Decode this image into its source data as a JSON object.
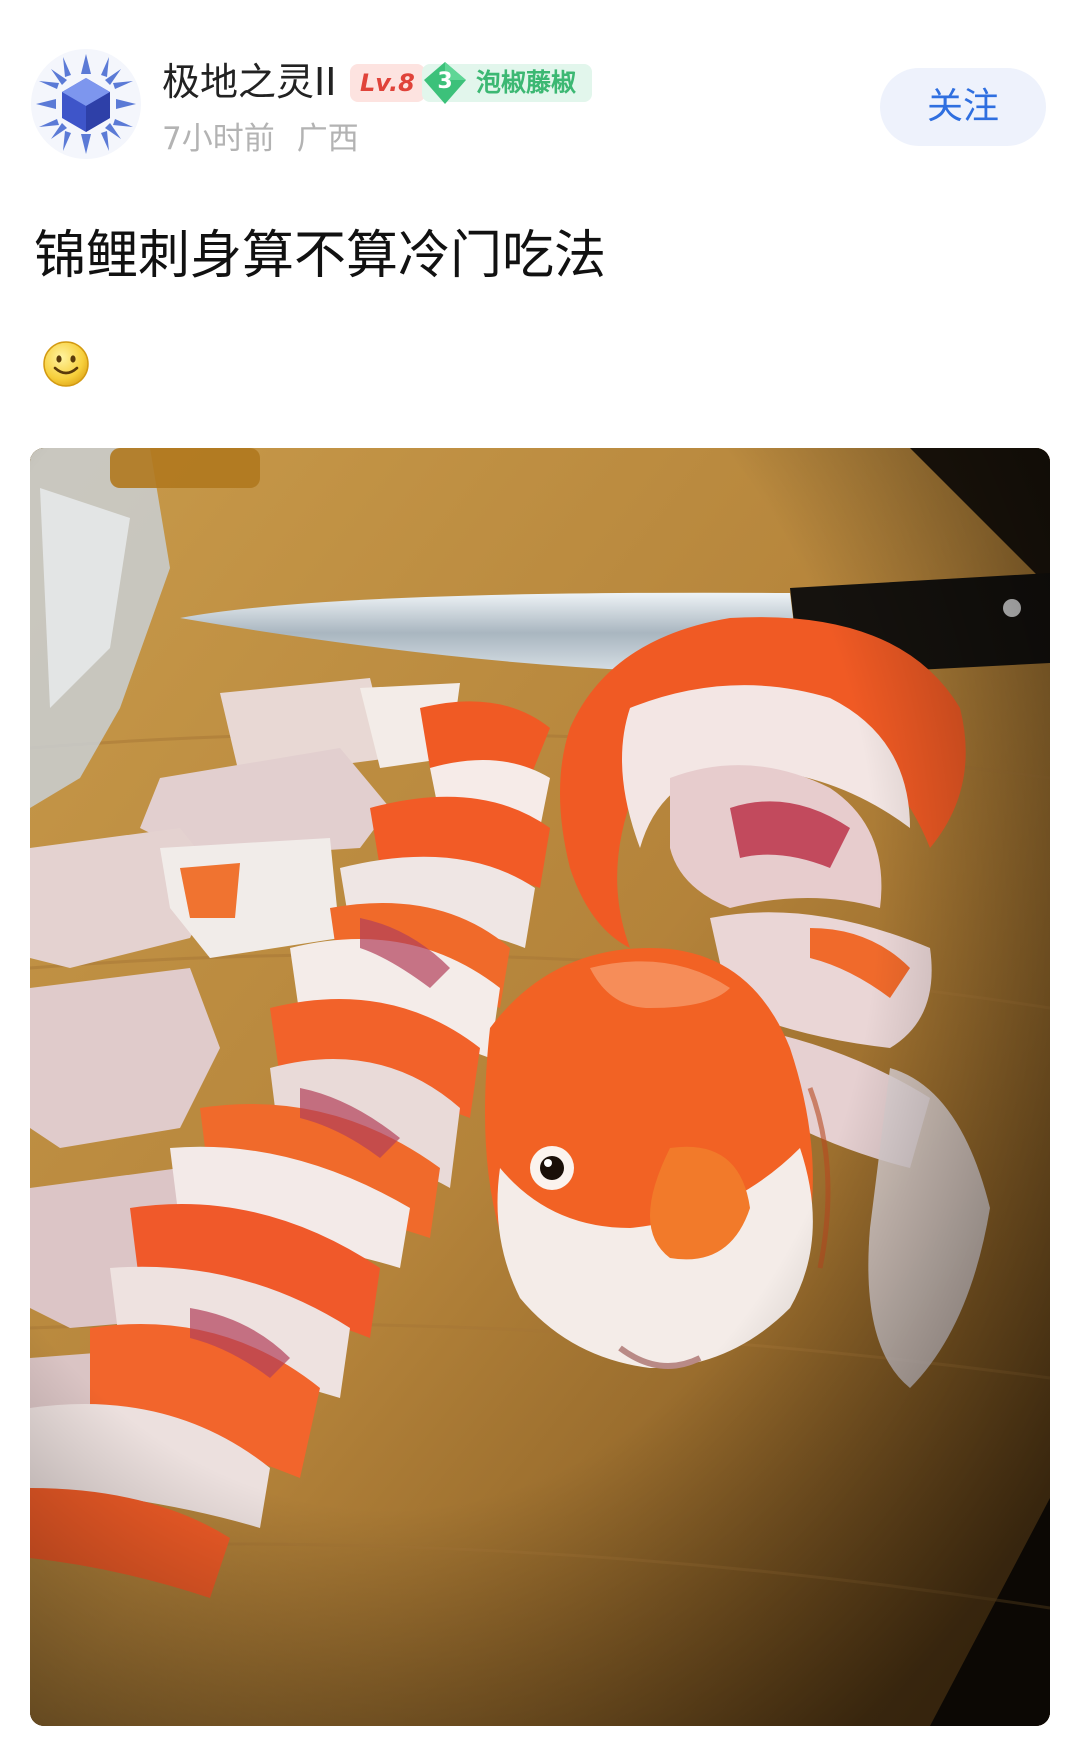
{
  "post": {
    "author": {
      "name": "极地之灵II",
      "level": "Lv.8",
      "circle_level": "3",
      "circle_name": "泡椒藤椒",
      "time": "7小时前",
      "location": "广西"
    },
    "follow_label": "关注",
    "title": "锦鲤刺身算不算冷门吃法",
    "emoji": "smiling-face",
    "image": "koi-sashimi-photo"
  },
  "colors": {
    "follow_text": "#2f6fe0",
    "follow_bg": "#eef2fc",
    "level_text": "#e0433a",
    "level_bg": "#fde3e0",
    "circle_text": "#3cb873",
    "circle_bg": "#e2f6ec",
    "meta_text": "#b3b3b3"
  }
}
